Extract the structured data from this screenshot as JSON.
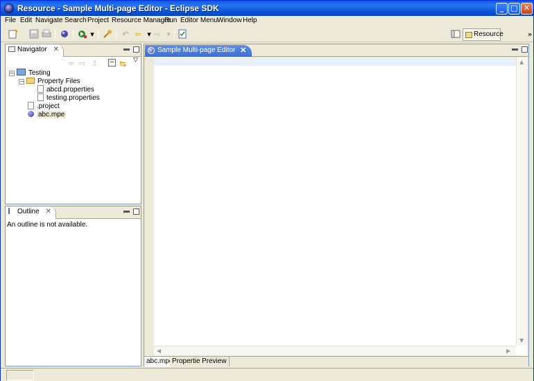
{
  "window": {
    "title": "Resource - Sample Multi-page Editor - Eclipse SDK",
    "controls": {
      "minimize": "_",
      "maximize": "□",
      "close": "✕"
    }
  },
  "menubar": [
    "File",
    "Edit",
    "Navigate",
    "Search",
    "Project",
    "Resource Manager",
    "Run",
    "Editor Menu",
    "Window",
    "Help"
  ],
  "toolbar": {
    "icons": [
      "new-icon",
      "save-icon",
      "print-icon",
      "debug-icon",
      "run-icon",
      "external-tools-icon",
      "search-icon",
      "back-icon",
      "forward-icon",
      "task-icon"
    ],
    "perspective_label": "Resource",
    "overflow": "»"
  },
  "navigator": {
    "tab_label": "Navigator",
    "close": "✕",
    "tree": [
      {
        "label": "Testing",
        "type": "project",
        "depth": 0,
        "expanded": true
      },
      {
        "label": "Property Files",
        "type": "folder",
        "depth": 1,
        "expanded": true
      },
      {
        "label": "abcd.properties",
        "type": "file",
        "depth": 2
      },
      {
        "label": "testing.properties",
        "type": "file",
        "depth": 2
      },
      {
        "label": ".project",
        "type": "file",
        "depth": 1
      },
      {
        "label": "abc.mpe",
        "type": "mpe",
        "depth": 1,
        "selected": true
      }
    ]
  },
  "outline": {
    "tab_label": "Outline",
    "close": "✕",
    "message": "An outline is not available."
  },
  "editor": {
    "tab_label": "Sample Multi-page Editor",
    "close": "✕",
    "pages": [
      {
        "label": "abc.mpe",
        "active": true
      },
      {
        "label": "Properties",
        "active": false
      },
      {
        "label": "Preview",
        "active": false
      }
    ]
  }
}
